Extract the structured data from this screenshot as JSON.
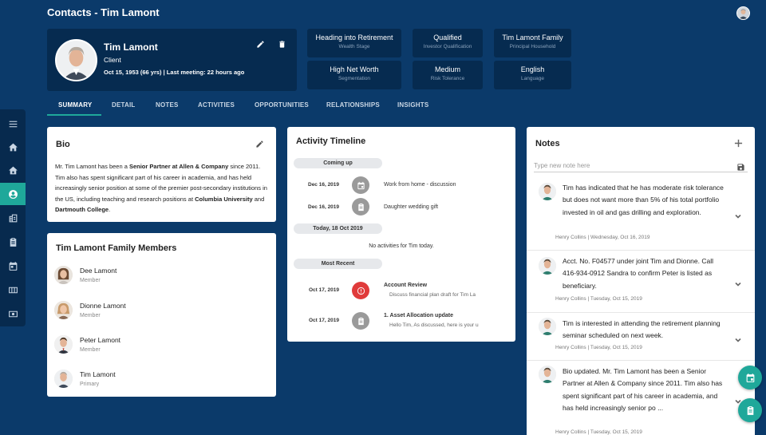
{
  "header": {
    "title": "Contacts - Tim Lamont"
  },
  "profile": {
    "name": "Tim Lamont",
    "role": "Client",
    "meta": "Oct 15, 1953 (66 yrs) | Last meeting: 22 hours ago"
  },
  "info_tiles": [
    {
      "value": "Heading into Retirement",
      "label": "Wealth Stage"
    },
    {
      "value": "Qualified",
      "label": "Investor Qualification"
    },
    {
      "value": "Tim Lamont Family",
      "label": "Principal Household"
    },
    {
      "value": "High Net Worth",
      "label": "Segmentation"
    },
    {
      "value": "Medium",
      "label": "Risk Tolerance"
    },
    {
      "value": "English",
      "label": "Language"
    }
  ],
  "tabs": [
    "SUMMARY",
    "DETAIL",
    "NOTES",
    "ACTIVITIES",
    "OPPORTUNITIES",
    "RELATIONSHIPS",
    "INSIGHTS"
  ],
  "bio": {
    "title": "Bio",
    "p1": "Mr. Tim Lamont has been a ",
    "b1": "Senior Partner at Allen & Company",
    "p2": " since 2011. Tim also has spent significant part of his career in academia, and has held increasingly senior position at some of the premier post-secondary institutions in the US, including teaching and research positions at ",
    "b2": "Columbia University",
    "p3": " and ",
    "b3": "Dartmouth College",
    "p4": "."
  },
  "family": {
    "title": "Tim Lamont Family Members",
    "members": [
      {
        "name": "Dee Lamont",
        "relation": "Member"
      },
      {
        "name": "Dionne Lamont",
        "relation": "Member"
      },
      {
        "name": "Peter Lamont",
        "relation": "Member"
      },
      {
        "name": "Tim Lamont",
        "relation": "Primary"
      }
    ]
  },
  "timeline": {
    "title": "Activity Timeline",
    "coming_up": "Coming up",
    "upcoming": [
      {
        "date": "Dec 16, 2019",
        "title": "Work from home - discussion",
        "icon": "calendar-icon"
      },
      {
        "date": "Dec 16, 2019",
        "title": "Daughter wedding gift",
        "icon": "clipboard-icon"
      }
    ],
    "today_label": "Today, 18 Oct 2019",
    "today_empty": "No activities for Tim today.",
    "most_recent": "Most Recent",
    "recent": [
      {
        "date": "Oct 17, 2019",
        "title": "Account Review",
        "sub": "Discuss financial plan draft for Tim La",
        "icon": "alert-icon"
      },
      {
        "date": "Oct 17, 2019",
        "title": "1. Asset Allocation update",
        "sub": "Hello Tim, As discussed, here is your u",
        "icon": "clipboard-icon"
      }
    ]
  },
  "notes": {
    "title": "Notes",
    "placeholder": "Type new note here",
    "items": [
      {
        "text": "Tim has indicated that he has moderate risk tolerance but does not want more than 5% of his total portfolio invested in oil and gas drilling and exploration.",
        "meta": "Henry Collins | Wednesday, Oct 16, 2019"
      },
      {
        "text": "Acct. No. F04577 under joint Tim and Dionne. Call 416-934-0912 Sandra to confirm Peter is listed as beneficiary.",
        "meta": "Henry Collins | Tuesday, Oct 15, 2019"
      },
      {
        "text": "Tim is interested in attending the retirement planning seminar scheduled on next week.",
        "meta": "Henry Collins | Tuesday, Oct 15, 2019"
      },
      {
        "text": "Bio updated. Mr. Tim Lamont has been a Senior Partner at Allen & Company since 2011. Tim also has spent significant part of his career in academia, and has held increasingly senior po ...",
        "meta": "Henry Collins | Tuesday, Oct 15, 2019"
      }
    ]
  },
  "colors": {
    "background": "#0b3a6a",
    "panel": "#062b50",
    "accent": "#1fa89a",
    "alert": "#e03b3b"
  }
}
